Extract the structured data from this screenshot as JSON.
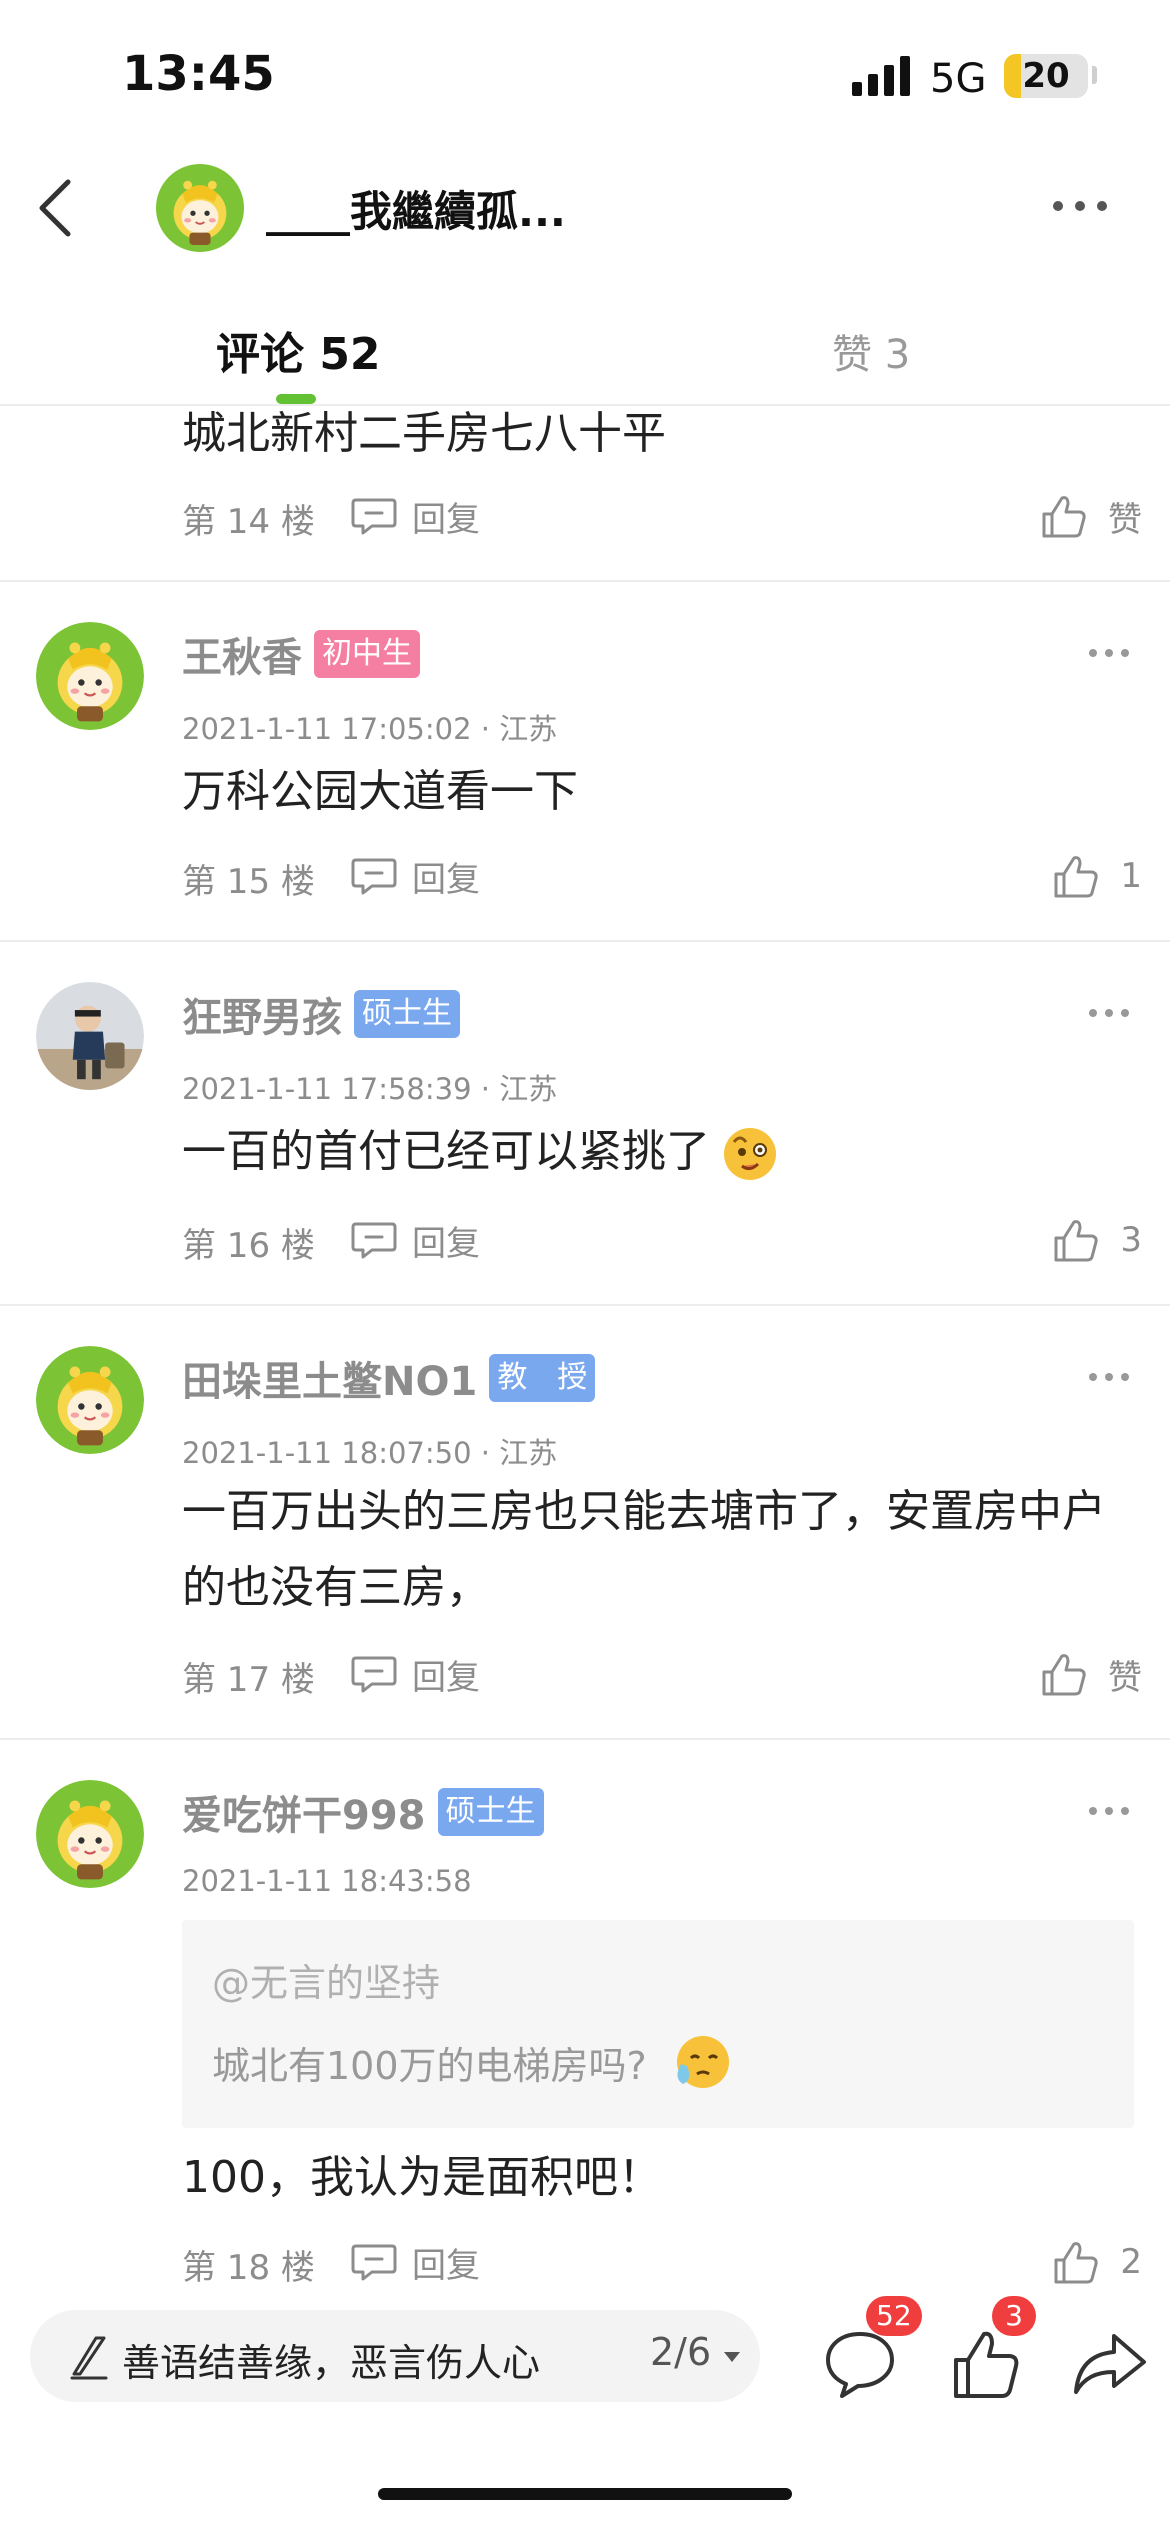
{
  "status_bar": {
    "time": "13:45",
    "network": "5G",
    "battery": "20",
    "battery_level": 0.2
  },
  "header": {
    "title": "____我繼續孤..."
  },
  "tabs": {
    "comments_label": "评论 52",
    "likes_label": "赞 3",
    "accent": "#63c233"
  },
  "comments": [
    {
      "content": "城北新村二手房七八十平",
      "floor": "第 14 楼",
      "reply": "回复",
      "likes": "赞"
    },
    {
      "user": "王秋香",
      "badge": "初中生",
      "meta": "2021-1-11 17:05:02 · 江苏",
      "content": "万科公园大道看一下",
      "floor": "第 15 楼",
      "reply": "回复",
      "likes": "1"
    },
    {
      "user": "狂野男孩",
      "badge": "硕士生",
      "meta": "2021-1-11 17:58:39 · 江苏",
      "content": "一百的首付已经可以紧挑了",
      "floor": "第 16 楼",
      "reply": "回复",
      "likes": "3"
    },
    {
      "user": "田垛里土鳖NO1",
      "badge": "教　授",
      "meta": "2021-1-11 18:07:50 · 江苏",
      "content": "一百万出头的三房也只能去塘市了，安置房中户的也没有三房，",
      "floor": "第 17 楼",
      "reply": "回复",
      "likes": "赞"
    },
    {
      "user": "爱吃饼干998",
      "badge": "硕士生",
      "meta": "2021-1-11 18:43:58",
      "quote_user": "@无言的坚持",
      "quote_text": "城北有100万的电梯房吗?",
      "content": "100，我认为是面积吧！",
      "floor": "第 18 楼",
      "reply": "回复",
      "likes": "2"
    }
  ],
  "bottom_bar": {
    "placeholder": "善语结善缘，恶言伤人心",
    "page": "2/6",
    "comment_count": "52",
    "like_count": "3"
  },
  "icons": {
    "back": "chevron-left-icon",
    "more": "more-dots-icon",
    "reply": "reply-bubble-icon",
    "like": "thumbs-up-icon",
    "share": "share-arrow-icon",
    "pen": "pen-icon"
  },
  "colors": {
    "badge_pink": "#f57fa3",
    "badge_blue": "#7aa8ef",
    "badge_red": "#f03d3d"
  }
}
